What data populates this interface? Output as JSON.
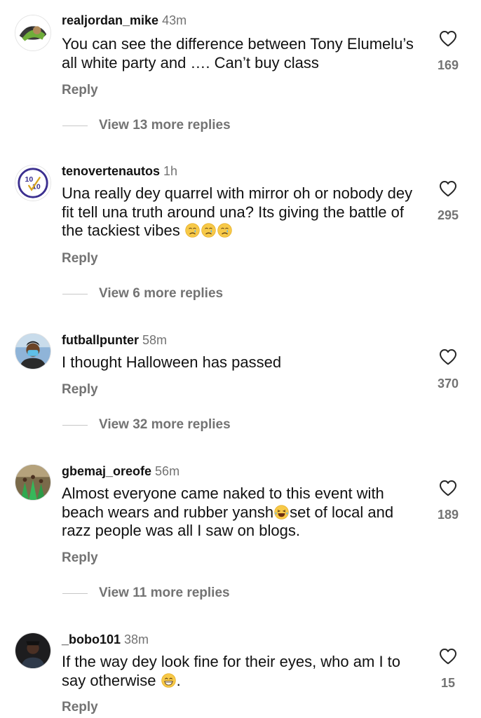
{
  "comments": [
    {
      "username": "realjordan_mike",
      "time": "43m",
      "text": "You can see the difference between Tony Elumelu’s all white party and …. Can’t buy class",
      "likes": "169",
      "reply_label": "Reply",
      "view_replies": "View 13 more replies"
    },
    {
      "username": "tenovertenautos",
      "time": "1h",
      "text": "Una really dey quarrel with mirror oh or nobody dey fit tell una truth around una? Its giving the battle of the tackiest vibes",
      "likes": "295",
      "reply_label": "Reply",
      "view_replies": "View 6 more replies",
      "avatar_text": "10/10"
    },
    {
      "username": "futballpunter",
      "time": "58m",
      "text": "I thought Halloween has passed",
      "likes": "370",
      "reply_label": "Reply",
      "view_replies": "View 32 more replies"
    },
    {
      "username": "gbemaj_oreofe",
      "time": "56m",
      "text_part1": "Almost everyone came naked to this event with beach wears and rubber yansh",
      "text_part2": "set of local and razz people was all I saw on blogs.",
      "likes": "189",
      "reply_label": "Reply",
      "view_replies": "View 11 more replies"
    },
    {
      "username": "_bobo101",
      "time": "38m",
      "text": "If the way dey look fine for their eyes, who am I to say otherwise",
      "text_end": ".",
      "likes": "15",
      "reply_label": "Reply"
    }
  ],
  "icons": {
    "like": "heart-outline-icon",
    "crying": "crying-face-emoji",
    "laughing": "tears-of-joy-emoji",
    "grinning": "grinning-face-emoji"
  },
  "colors": {
    "text": "#111111",
    "secondary": "#737373",
    "divider": "#c7c7c7",
    "badge_blue": "#3b2f8f",
    "badge_gold": "#d8a520"
  }
}
